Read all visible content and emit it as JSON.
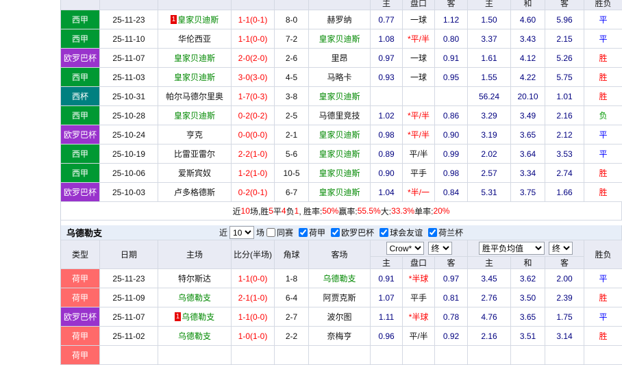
{
  "colors": {
    "badge": {
      "西甲": "#009933",
      "欧罗巴杯": "#9933CC",
      "西杯": "#008080",
      "荷甲": "#FF6A6A"
    },
    "focal": "#008800",
    "score": "#FF0000",
    "odds": "#000080",
    "result": {
      "胜": "#FF0000",
      "平": "#0000FF",
      "负": "#009900"
    }
  },
  "columns_top": [
    "主",
    "盘口",
    "客",
    "主",
    "和",
    "客",
    "胜负"
  ],
  "table1": {
    "rows": [
      {
        "league": "西甲",
        "date": "25-11-23",
        "home": "皇家贝迪斯",
        "home_focal": true,
        "home_card": "1",
        "score": "1-1(0-1)",
        "corner": "8-0",
        "away": "赫罗纳",
        "away_focal": false,
        "ah": "0.77",
        "hc": "一球",
        "hc_red": false,
        "aa": "1.12",
        "eh": "1.50",
        "ed": "4.60",
        "ea": "5.96",
        "result": "平"
      },
      {
        "league": "西甲",
        "date": "25-11-10",
        "home": "华伦西亚",
        "home_focal": false,
        "score": "1-1(0-0)",
        "corner": "7-2",
        "away": "皇家贝迪斯",
        "away_focal": true,
        "ah": "1.08",
        "hc": "*平/半",
        "hc_red": true,
        "aa": "0.80",
        "eh": "3.37",
        "ed": "3.43",
        "ea": "2.15",
        "result": "平"
      },
      {
        "league": "欧罗巴杯",
        "date": "25-11-07",
        "home": "皇家贝迪斯",
        "home_focal": true,
        "score": "2-0(2-0)",
        "corner": "2-6",
        "away": "里昂",
        "away_focal": false,
        "ah": "0.97",
        "hc": "一球",
        "hc_red": false,
        "aa": "0.91",
        "eh": "1.61",
        "ed": "4.12",
        "ea": "5.26",
        "result": "胜"
      },
      {
        "league": "西甲",
        "date": "25-11-03",
        "home": "皇家贝迪斯",
        "home_focal": true,
        "score": "3-0(3-0)",
        "corner": "4-5",
        "away": "马略卡",
        "away_focal": false,
        "ah": "0.93",
        "hc": "一球",
        "hc_red": false,
        "aa": "0.95",
        "eh": "1.55",
        "ed": "4.22",
        "ea": "5.75",
        "result": "胜"
      },
      {
        "league": "西杯",
        "date": "25-10-31",
        "home": "帕尔马德尔里奥",
        "home_focal": false,
        "score": "1-7(0-3)",
        "corner": "3-8",
        "away": "皇家贝迪斯",
        "away_focal": true,
        "ah": "",
        "hc": "",
        "hc_red": false,
        "aa": "",
        "eh": "56.24",
        "ed": "20.10",
        "ea": "1.01",
        "result": "胜"
      },
      {
        "league": "西甲",
        "date": "25-10-28",
        "home": "皇家贝迪斯",
        "home_focal": true,
        "score": "0-2(0-2)",
        "corner": "2-5",
        "away": "马德里竞技",
        "away_focal": false,
        "ah": "1.02",
        "hc": "*平/半",
        "hc_red": true,
        "aa": "0.86",
        "eh": "3.29",
        "ed": "3.49",
        "ea": "2.16",
        "result": "负"
      },
      {
        "league": "欧罗巴杯",
        "date": "25-10-24",
        "home": "亨克",
        "home_focal": false,
        "score": "0-0(0-0)",
        "corner": "2-1",
        "away": "皇家贝迪斯",
        "away_focal": true,
        "ah": "0.98",
        "hc": "*平/半",
        "hc_red": true,
        "aa": "0.90",
        "eh": "3.19",
        "ed": "3.65",
        "ea": "2.12",
        "result": "平"
      },
      {
        "league": "西甲",
        "date": "25-10-19",
        "home": "比雷亚雷尔",
        "home_focal": false,
        "score": "2-2(1-0)",
        "corner": "5-6",
        "away": "皇家贝迪斯",
        "away_focal": true,
        "ah": "0.89",
        "hc": "平/半",
        "hc_red": false,
        "aa": "0.99",
        "eh": "2.02",
        "ed": "3.64",
        "ea": "3.53",
        "result": "平"
      },
      {
        "league": "西甲",
        "date": "25-10-06",
        "home": "爱斯宾奴",
        "home_focal": false,
        "score": "1-2(1-0)",
        "corner": "10-5",
        "away": "皇家贝迪斯",
        "away_focal": true,
        "ah": "0.90",
        "hc": "平手",
        "hc_red": false,
        "aa": "0.98",
        "eh": "2.57",
        "ed": "3.34",
        "ea": "2.74",
        "result": "胜"
      },
      {
        "league": "欧罗巴杯",
        "date": "25-10-03",
        "home": "卢多格德斯",
        "home_focal": false,
        "score": "0-2(0-1)",
        "corner": "6-7",
        "away": "皇家贝迪斯",
        "away_focal": true,
        "ah": "1.04",
        "hc": "*半/一",
        "hc_red": true,
        "aa": "0.84",
        "eh": "5.31",
        "ed": "3.75",
        "ea": "1.66",
        "result": "胜"
      }
    ]
  },
  "summary": {
    "segments": [
      {
        "t": "近",
        "red": false
      },
      {
        "t": "10",
        "red": true
      },
      {
        "t": "场,胜",
        "red": false
      },
      {
        "t": "5",
        "red": true
      },
      {
        "t": "平",
        "red": false
      },
      {
        "t": "4",
        "red": true
      },
      {
        "t": "负",
        "red": false
      },
      {
        "t": "1",
        "red": true
      },
      {
        "t": ", 胜率:",
        "red": false
      },
      {
        "t": "50%",
        "red": true
      },
      {
        "t": " 赢率:",
        "red": false
      },
      {
        "t": "55.5%",
        "red": true
      },
      {
        "t": " 大:",
        "red": false
      },
      {
        "t": "33.3%",
        "red": true
      },
      {
        "t": " 单率:",
        "red": false
      },
      {
        "t": "20%",
        "red": true
      }
    ]
  },
  "section2": {
    "title": "乌德勒支",
    "filter": {
      "near_label": "近",
      "count": "10",
      "matches_label": "场",
      "same_label": "同赛",
      "same_checked": false,
      "leagues": [
        {
          "label": "荷甲",
          "checked": true
        },
        {
          "label": "欧罗巴杯",
          "checked": true
        },
        {
          "label": "球会友谊",
          "checked": true
        },
        {
          "label": "荷兰杯",
          "checked": true
        }
      ]
    },
    "dropdowns": {
      "bookmaker": "Crow*",
      "final1": "终",
      "avg": "胜平负均值",
      "final2": "终"
    },
    "header": {
      "type": "类型",
      "date": "日期",
      "home": "主场",
      "score": "比分(半场)",
      "corner": "角球",
      "away": "客场",
      "h": "主",
      "handicap": "盘口",
      "a": "客",
      "eh": "主",
      "ed": "和",
      "ea": "客",
      "result": "胜负"
    },
    "rows": [
      {
        "league": "荷甲",
        "date": "25-11-23",
        "home": "特尔斯达",
        "home_focal": false,
        "score": "1-1(0-0)",
        "corner": "1-8",
        "away": "乌德勒支",
        "away_focal": true,
        "ah": "0.91",
        "hc": "*半球",
        "hc_red": true,
        "aa": "0.97",
        "eh": "3.45",
        "ed": "3.62",
        "ea": "2.00",
        "result": "平"
      },
      {
        "league": "荷甲",
        "date": "25-11-09",
        "home": "乌德勒支",
        "home_focal": true,
        "score": "2-1(1-0)",
        "corner": "6-4",
        "away": "阿贾克斯",
        "away_focal": false,
        "ah": "1.07",
        "hc": "平手",
        "hc_red": false,
        "aa": "0.81",
        "eh": "2.76",
        "ed": "3.50",
        "ea": "2.39",
        "result": "胜"
      },
      {
        "league": "欧罗巴杯",
        "date": "25-11-07",
        "home": "乌德勒支",
        "home_focal": true,
        "home_card": "1",
        "score": "1-1(0-0)",
        "corner": "2-7",
        "away": "波尔图",
        "away_focal": false,
        "ah": "1.11",
        "hc": "*半球",
        "hc_red": true,
        "aa": "0.78",
        "eh": "4.76",
        "ed": "3.65",
        "ea": "1.75",
        "result": "平"
      },
      {
        "league": "荷甲",
        "date": "25-11-02",
        "home": "乌德勒支",
        "home_focal": true,
        "score": "1-0(1-0)",
        "corner": "2-2",
        "away": "奈梅亨",
        "away_focal": false,
        "ah": "0.96",
        "hc": "平/半",
        "hc_red": false,
        "aa": "0.92",
        "eh": "2.16",
        "ed": "3.51",
        "ea": "3.14",
        "result": "胜"
      },
      {
        "league": "荷甲",
        "date": "",
        "home": "",
        "home_focal": false,
        "score": "",
        "corner": "",
        "away": "",
        "away_focal": false,
        "ah": "",
        "hc": "",
        "hc_red": false,
        "aa": "",
        "eh": "",
        "ed": "",
        "ea": "",
        "result": ""
      }
    ]
  }
}
